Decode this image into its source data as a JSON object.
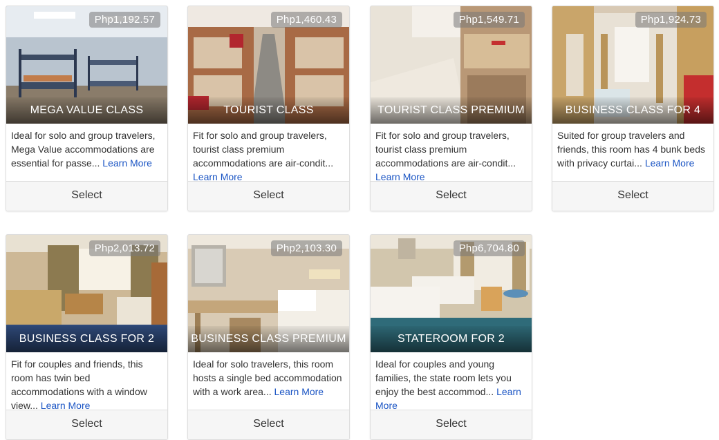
{
  "select_label": "Select",
  "learn_more_label": "Learn More",
  "accommodations": [
    {
      "name": "MEGA VALUE CLASS",
      "price": "Php1,192.57",
      "description": "Ideal for solo and group travelers, Mega Value accommodations are essential for passe...",
      "photo_icon": "bunk-beds-icon"
    },
    {
      "name": "TOURIST CLASS",
      "price": "Php1,460.43",
      "description": "Fit for solo and group travelers, tourist class premium accommodations are air-condit...",
      "photo_icon": "bunk-aisle-icon"
    },
    {
      "name": "TOURIST CLASS PREMIUM",
      "price": "Php1,549.71",
      "description": "Fit for solo and group travelers, tourist class premium accommodations are air-condit...",
      "photo_icon": "bunk-bed-icon"
    },
    {
      "name": "BUSINESS CLASS FOR 4",
      "price": "Php1,924.73",
      "description": "Suited for group travelers and friends, this room has 4 bunk beds with privacy curtai...",
      "photo_icon": "curtained-room-icon"
    },
    {
      "name": "BUSINESS CLASS FOR 2",
      "price": "Php2,013.72",
      "description": "Fit for couples and friends, this room has twin bed accommodations with a window view...",
      "photo_icon": "twin-bed-room-icon"
    },
    {
      "name": "BUSINESS CLASS PREMIUM",
      "price": "Php2,103.30",
      "description": "Ideal for solo travelers, this room hosts a single bed accommodation with a work area...",
      "photo_icon": "single-bed-desk-icon"
    },
    {
      "name": "STATEROOM FOR 2",
      "price": "Php6,704.80",
      "description": "Ideal for couples and young families, the state room lets you enjoy the best accommod...",
      "photo_icon": "stateroom-icon"
    }
  ]
}
